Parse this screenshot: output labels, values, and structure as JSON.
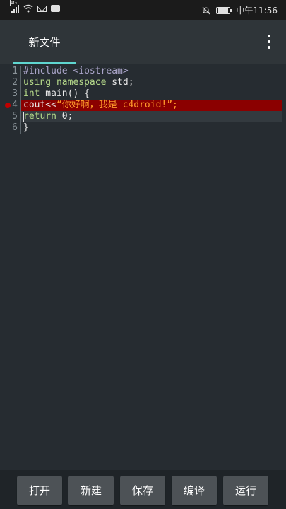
{
  "status_bar": {
    "network_label": "4G",
    "time": "中午11:56",
    "icons": [
      "signal-icon",
      "wifi-icon",
      "mail-icon",
      "message-icon",
      "bell-muted-icon",
      "battery-icon"
    ],
    "battery_level": 0.85
  },
  "app_bar": {
    "tab_label": "新文件",
    "accent_color": "#5fd6d0",
    "menu_icon": "more-vert-icon"
  },
  "editor": {
    "error_line": 4,
    "current_line": 5,
    "lines": [
      {
        "number": "1",
        "parts": [
          "#include <iostream>"
        ]
      },
      {
        "number": "2",
        "parts": [
          "using",
          " ",
          "namespace",
          " std;"
        ]
      },
      {
        "number": "3",
        "parts": [
          "int",
          " main() {"
        ]
      },
      {
        "number": "4",
        "parts": [
          "cout<<",
          "“你好啊，我是 c4droid!”;"
        ]
      },
      {
        "number": "5",
        "parts": [
          "return",
          " 0;"
        ]
      },
      {
        "number": "6",
        "parts": [
          "}"
        ]
      }
    ]
  },
  "toolbar": {
    "open_label": "打开",
    "new_label": "新建",
    "save_label": "保存",
    "compile_label": "编译",
    "run_label": "运行"
  }
}
